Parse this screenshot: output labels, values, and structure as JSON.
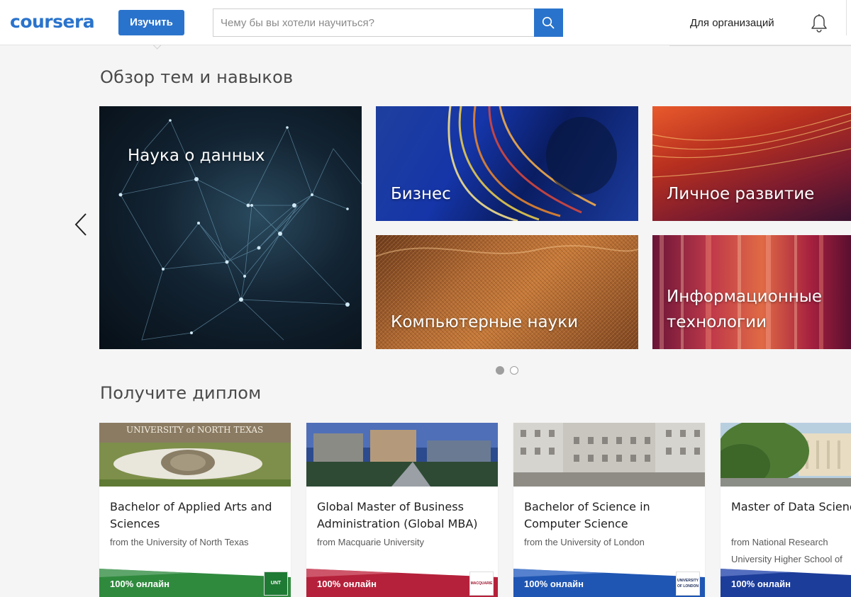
{
  "header": {
    "logo_text": "coursera",
    "learn_label": "Изучить",
    "search_placeholder": "Чему бы вы хотели научиться?",
    "org_label": "Для организаций"
  },
  "topics": {
    "title": "Обзор тем и навыков",
    "tiles": [
      {
        "label": "Наука о данных"
      },
      {
        "label": "Бизнес"
      },
      {
        "label": "Личное развитие"
      },
      {
        "label": "Компьютерные науки"
      },
      {
        "label": "Информационные технологии"
      }
    ]
  },
  "degrees": {
    "title": "Получите диплом",
    "cards": [
      {
        "title": "Bachelor of Applied Arts and Sciences",
        "subtitle": "from the University of North Texas",
        "band": "100% онлайн",
        "sign": "UNIVERSITY of NORTH TEXAS",
        "badge": "UNT",
        "band_color": "#2f8a3e"
      },
      {
        "title": "Global Master of Business Administration (Global MBA)",
        "subtitle": "from Macquarie University",
        "band": "100% онлайн",
        "badge": "MACQUARIE",
        "band_color": "#b5213a"
      },
      {
        "title": "Bachelor of Science in Computer Science",
        "subtitle": "from the University of London",
        "band": "100% онлайн",
        "badge": "UNIVERSITY OF LONDON",
        "band_color": "#1f56b3"
      },
      {
        "title": "Master of Data Science",
        "subtitle": "from National Research University Higher School of Economics",
        "band": "100% онлайн",
        "band_color": "#1d3d9a"
      }
    ]
  },
  "icons": {
    "search": "search-icon",
    "bell": "bell-icon",
    "prev": "chevron-left-icon"
  },
  "colors": {
    "brand": "#2a73cc",
    "background": "#f5f5f5"
  }
}
